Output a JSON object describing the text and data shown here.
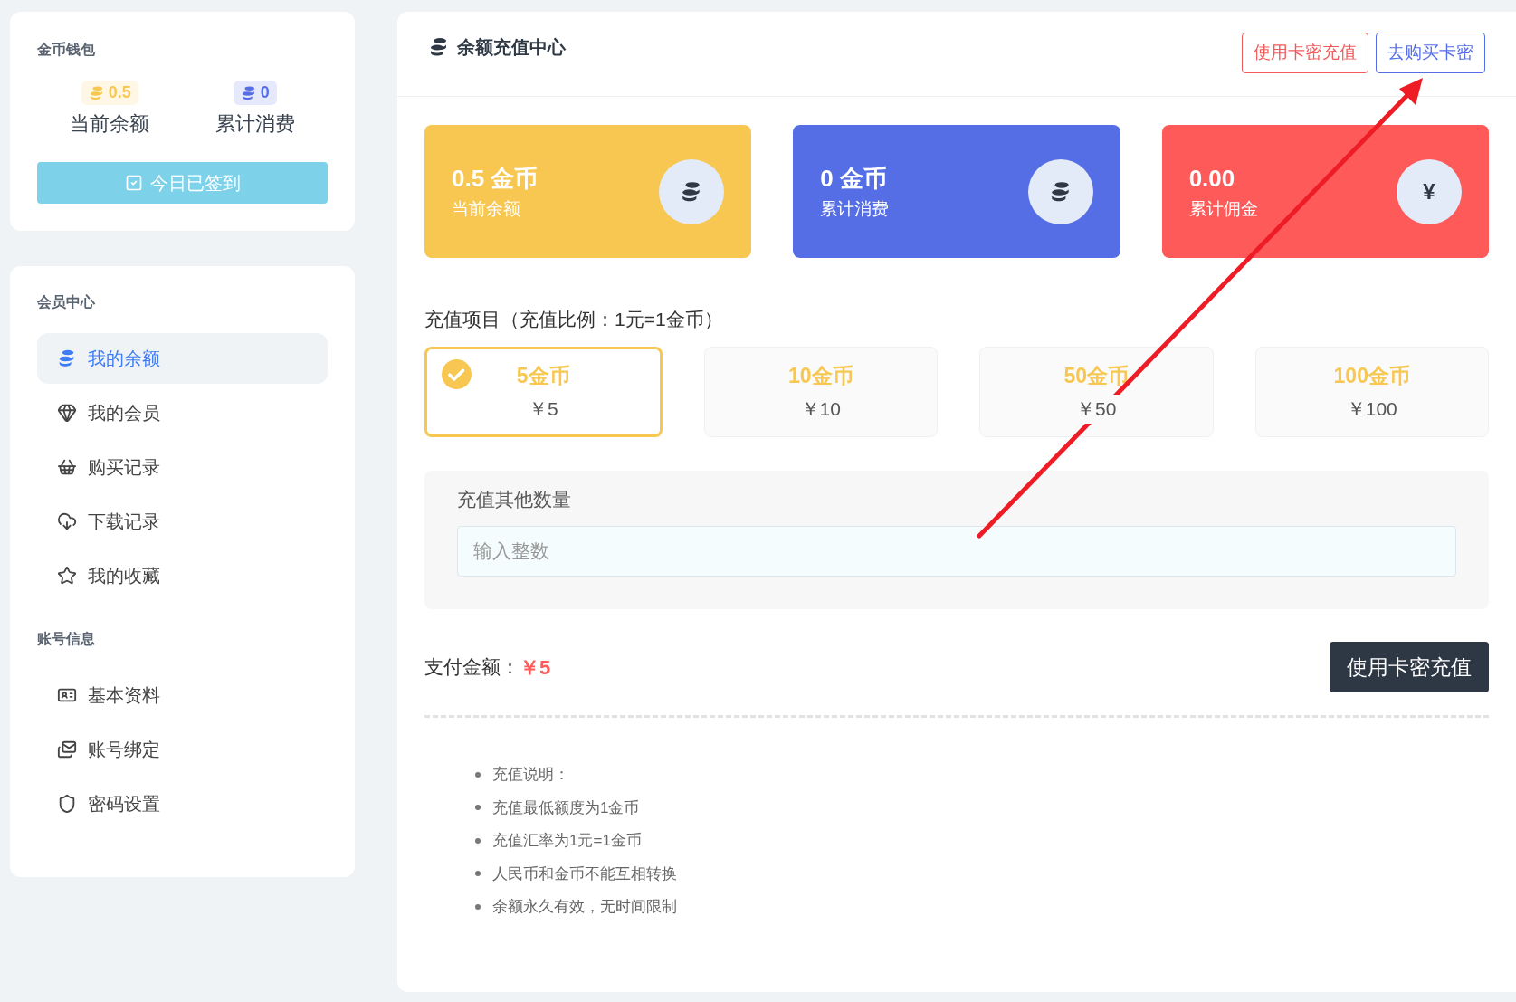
{
  "wallet": {
    "title": "金币钱包",
    "stats": [
      {
        "value": "0.5",
        "label": "当前余额",
        "color": "#f7c752"
      },
      {
        "value": "0",
        "label": "累计消费",
        "color": "#556ee6"
      }
    ],
    "checkin": {
      "label": "今日已签到",
      "done": true
    }
  },
  "sidebar": {
    "sections": [
      {
        "title": "会员中心",
        "items": [
          {
            "label": "我的余额",
            "selected": true
          },
          {
            "label": "我的会员",
            "selected": false
          },
          {
            "label": "购买记录",
            "selected": false
          },
          {
            "label": "下载记录",
            "selected": false
          },
          {
            "label": "我的收藏",
            "selected": false
          }
        ]
      },
      {
        "title": "账号信息",
        "items": [
          {
            "label": "基本资料",
            "selected": false
          },
          {
            "label": "账号绑定",
            "selected": false
          },
          {
            "label": "密码设置",
            "selected": false
          }
        ]
      }
    ]
  },
  "main": {
    "title": "余额充值中心",
    "header_buttons": [
      {
        "label": "使用卡密充值",
        "color": "#f15b5b"
      },
      {
        "label": "去购买卡密",
        "color": "#556ee6"
      }
    ],
    "cards": [
      {
        "value": "0.5 金币",
        "label": "当前余额",
        "color": "#f7c752"
      },
      {
        "value": "0 金币",
        "label": "累计消费",
        "color": "#556ee6"
      },
      {
        "value": "0.00",
        "label": "累计佣金",
        "color": "#ff5a5a",
        "symbol": "¥"
      }
    ],
    "options_title": "充值项目（充值比例：1元=1金币）",
    "options": [
      {
        "coins": "5金币",
        "price": "￥5",
        "selected": true
      },
      {
        "coins": "10金币",
        "price": "￥10",
        "selected": false
      },
      {
        "coins": "50金币",
        "price": "￥50",
        "selected": false
      },
      {
        "coins": "100金币",
        "price": "￥100",
        "selected": false
      }
    ],
    "other": {
      "label": "充值其他数量",
      "placeholder": "输入整数"
    },
    "pay": {
      "label": "支付金额：",
      "amount": "￥5"
    },
    "submit": "使用卡密充值",
    "notes": [
      "充值说明：",
      "充值最低额度为1金币",
      "充值汇率为1元=1金币",
      "人民币和金币不能互相转换",
      "余额永久有效，无时间限制"
    ]
  }
}
